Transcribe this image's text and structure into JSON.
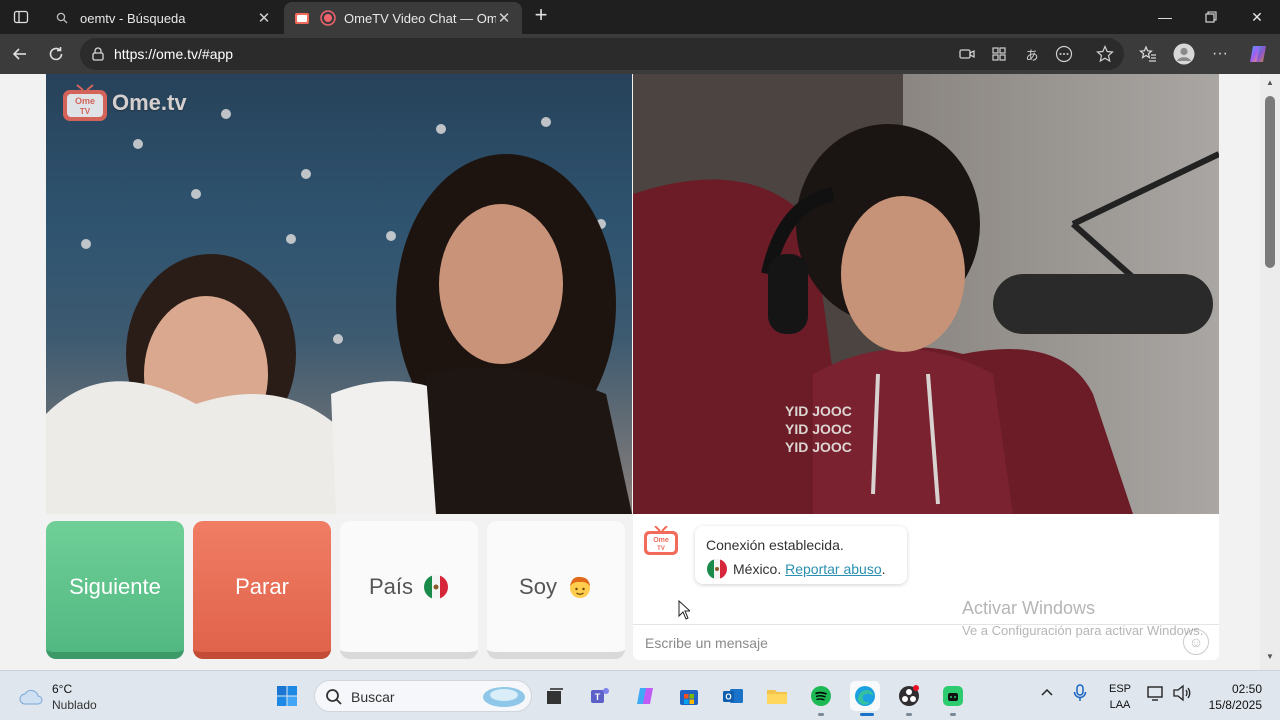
{
  "browser": {
    "tabs": [
      {
        "title": "oemtv - Búsqueda",
        "favicon": "search-icon",
        "active": false
      },
      {
        "title": "OmeTV Video Chat — Omeg",
        "favicon": "ometv-favicon",
        "active": true
      }
    ],
    "url": "https://ome.tv/#app"
  },
  "app": {
    "logo_text": "Ome.tv",
    "logo_badge": "Ome\nTV",
    "buttons": {
      "next": "Siguiente",
      "stop": "Parar",
      "country": "País",
      "country_flag": "mexico-flag-icon",
      "gender": "Soy",
      "gender_icon": "boy-emoji-icon"
    },
    "chat": {
      "status": "Conexión establecida.",
      "country": "México.",
      "report_link": "Reportar abuso",
      "report_suffix": ".",
      "placeholder": "Escribe un mensaje"
    }
  },
  "watermark": {
    "title": "Activar Windows",
    "subtitle": "Ve a Configuración para activar Windows."
  },
  "taskbar": {
    "weather": {
      "temp": "6°C",
      "condition": "Nublado"
    },
    "search_label": "Buscar",
    "language": [
      "ESP",
      "LAA"
    ],
    "time": "02:50",
    "date": "15/8/2025"
  },
  "colors": {
    "next": "#52b882",
    "stop": "#e0634a",
    "link": "#2a8fb0"
  }
}
